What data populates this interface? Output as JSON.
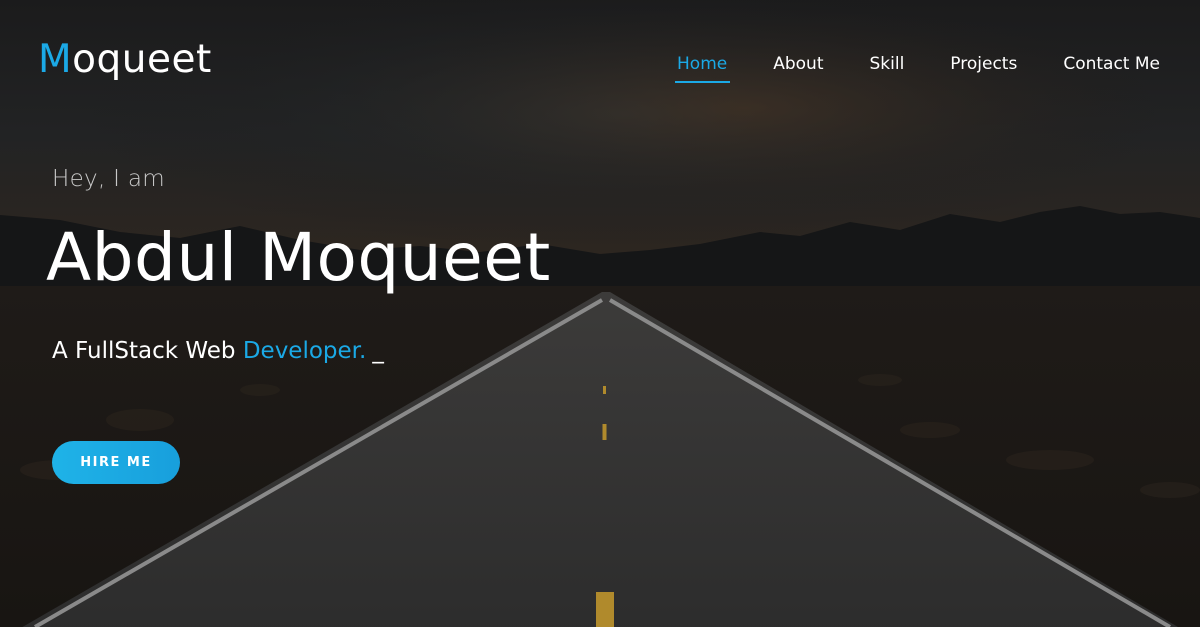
{
  "brand": {
    "initial": "M",
    "rest": "oqueet"
  },
  "nav": {
    "items": [
      {
        "label": "Home",
        "active": true
      },
      {
        "label": "About",
        "active": false
      },
      {
        "label": "Skill",
        "active": false
      },
      {
        "label": "Projects",
        "active": false
      },
      {
        "label": "Contact Me",
        "active": false
      }
    ]
  },
  "hero": {
    "greeting": "Hey, I am",
    "name": "Abdul Moqueet",
    "tagline_prefix": "A FullStack Web",
    "tagline_role": "Developer.",
    "cursor": "_",
    "cta_label": "HIRE ME"
  },
  "colors": {
    "accent": "#1ba9e6",
    "text": "#ffffff",
    "background": "#141414"
  },
  "background_image": "dark desert road at dusk"
}
